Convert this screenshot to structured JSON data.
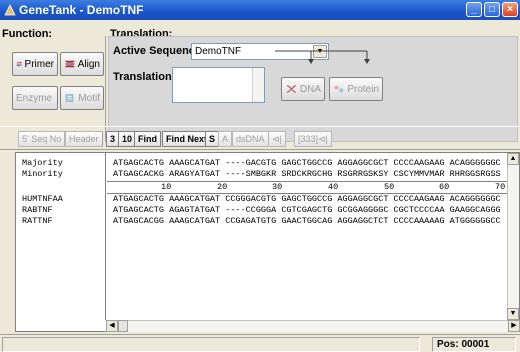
{
  "window": {
    "title": "GeneTank - DemoTNF",
    "min": "_",
    "max": "□",
    "close": "×"
  },
  "function_panel": {
    "label": "Function:",
    "primer": "Primer",
    "align": "Align",
    "enzyme": "Enzyme",
    "motif": "Motif"
  },
  "translation_panel": {
    "label": "Translation:",
    "active_seq_label": "Active Sequence:",
    "active_seq_value": "DemoTNF",
    "translations_label": "Translations:",
    "dna": "DNA",
    "protein": "Protein"
  },
  "toolbar": {
    "seq_no": "5' Seq No",
    "header": "Header",
    "n3": "3",
    "n10": "10",
    "find": "Find",
    "find_next": "Find Next",
    "s": "S",
    "a": "A",
    "dsdna": "dsDNA",
    "t1": "⊲|",
    "t2": "[333]⊲|"
  },
  "sequences": {
    "names": [
      "Majority",
      "Minority",
      "",
      "HUMTNFAA",
      "RABTNF",
      "RATTNF"
    ],
    "rows": [
      "ATGAGCACTG AAAGCATGAT ----GACGTG GAGCTGGCCG AGGAGGCGCT CCCCAAGAAG ACAGGGGGGC",
      "ATGAGCACKG ARAGYATGAT ----SMBGKR SRDCKRGCHG RSGRRGSKSY CSCYMMVMAR RHRGGSRGSS",
      "",
      "ATGAGCACTG AAAGCATGAT CCGGGACGTG GAGCTGGCCG AGGAGGCGCT CCCCAAGAAG ACAGGGGGGC",
      "ATGAGCACTG AGAGTATGAT ----CCGGGA CGTCGAGCTG GCGGAGGGGC CGCTCCCCAA GAAGGCAGGG",
      "ATGAGCACGG AAAGCATGAT CCGAGATGTG GAACTGGCAG AGGAGGCTCT CCCCAAAAAG ATGGGGGGCC"
    ],
    "ruler": [
      "10",
      "20",
      "30",
      "40",
      "50",
      "60",
      "70"
    ]
  },
  "status": {
    "pos": "Pos:  00001"
  }
}
